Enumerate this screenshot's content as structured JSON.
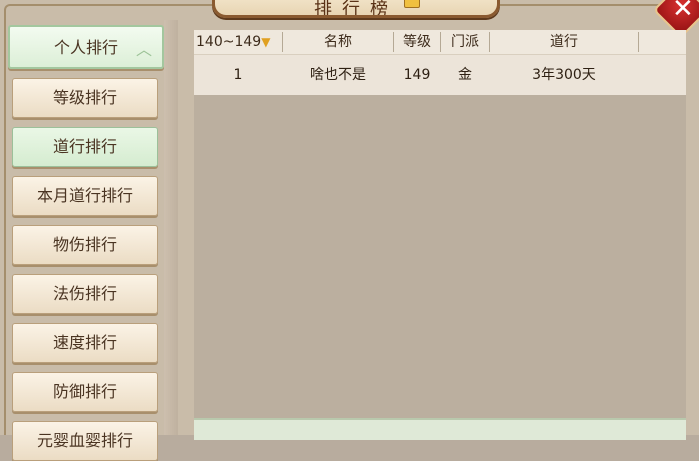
{
  "title": "排行榜",
  "sidebar": {
    "items": [
      {
        "label": "个人排行",
        "state": "expanded"
      },
      {
        "label": "等级排行",
        "state": "normal"
      },
      {
        "label": "道行排行",
        "state": "selected"
      },
      {
        "label": "本月道行排行",
        "state": "normal"
      },
      {
        "label": "物伤排行",
        "state": "normal"
      },
      {
        "label": "法伤排行",
        "state": "normal"
      },
      {
        "label": "速度排行",
        "state": "normal"
      },
      {
        "label": "防御排行",
        "state": "normal"
      },
      {
        "label": "元婴血婴排行",
        "state": "partially-visible"
      }
    ]
  },
  "table": {
    "filter": "140~149",
    "columns": [
      "名称",
      "等级",
      "门派",
      "道行"
    ],
    "rows": [
      {
        "rank": "1",
        "name": "啥也不是",
        "level": "149",
        "school": "金",
        "daohang": "3年300天"
      }
    ]
  },
  "icons": {
    "close": "close-x-icon",
    "collapse": "chevron-up-icon",
    "filter": "chevron-down-icon"
  },
  "colors": {
    "accent": "#e0a020",
    "close": "#c21d1d",
    "selected_tab": "#dcefd7"
  }
}
